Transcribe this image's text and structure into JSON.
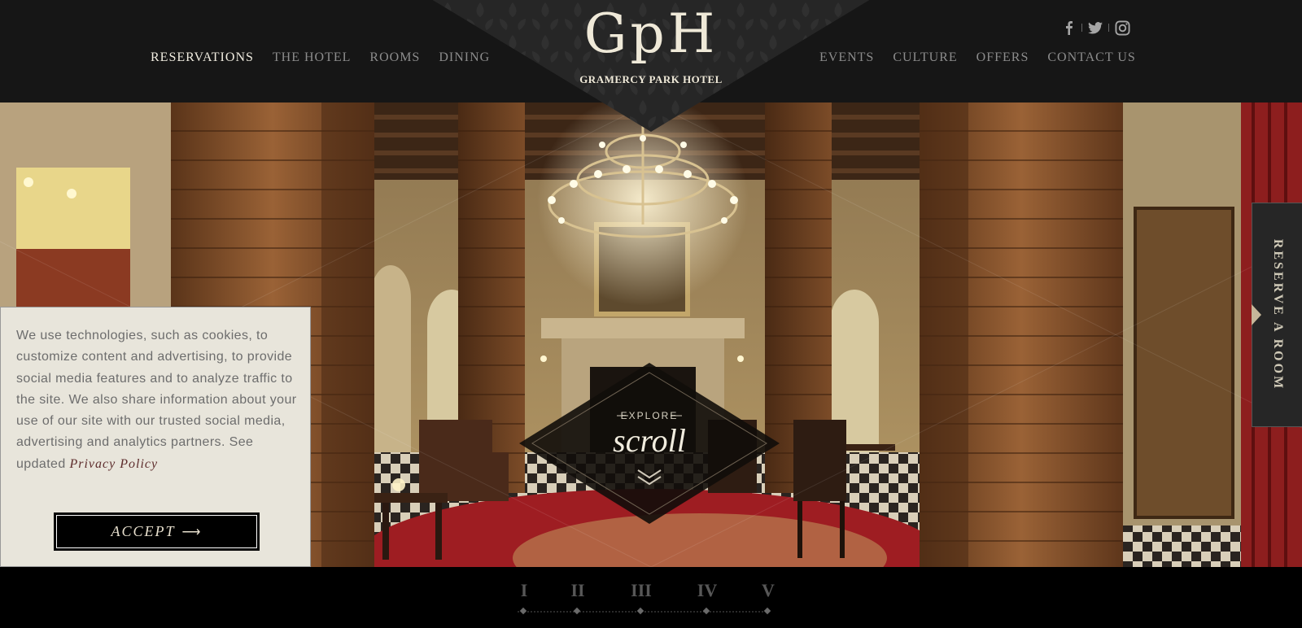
{
  "brand": {
    "mark": "GpH",
    "name": "GRAMERCY PARK HOTEL"
  },
  "nav_left": [
    "RESERVATIONS",
    "THE HOTEL",
    "ROOMS",
    "DINING"
  ],
  "nav_right": [
    "EVENTS",
    "CULTURE",
    "OFFERS",
    "CONTACT US"
  ],
  "social_icons": [
    "facebook-icon",
    "twitter-icon",
    "instagram-icon"
  ],
  "explore": {
    "label": "EXPLORE",
    "word": "scroll"
  },
  "reserve_tab": "RESERVE A ROOM",
  "cookie": {
    "text": "We use technologies, such as cookies, to customize content and advertising, to provide social media features and to analyze traffic to the site. We also share information about your use of our site with our trusted social media, advertising and analytics partners. See updated ",
    "link": "Privacy Policy",
    "accept": "ACCEPT",
    "accept_arrow": "⟶"
  },
  "pager": [
    "I",
    "II",
    "III",
    "IV",
    "V"
  ],
  "colors": {
    "header_bg": "#161616",
    "cream": "#efe9d8",
    "wood": "#7a4a28",
    "carpet_red": "#9e1d22",
    "cookie_bg": "#e8e5db"
  }
}
